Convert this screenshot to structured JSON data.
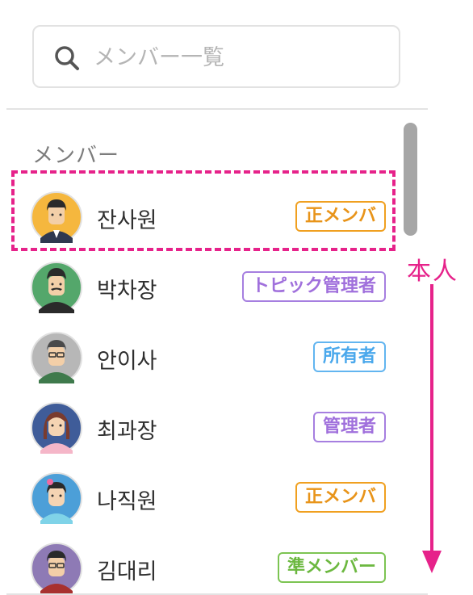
{
  "search": {
    "placeholder": "メンバー一覧",
    "icon": "search-icon"
  },
  "section": {
    "title": "メンバー"
  },
  "members": [
    {
      "name": "잔사원",
      "role": "正メンバ",
      "role_color": "#f0a020",
      "role_text_color": "#e8941a",
      "avatar_bg": "#f5b73e"
    },
    {
      "name": "박차장",
      "role": "トピック管理者",
      "role_color": "#a67fe0",
      "role_text_color": "#a070dc",
      "avatar_bg": "#54a76b"
    },
    {
      "name": "안이사",
      "role": "所有者",
      "role_color": "#62b5f0",
      "role_text_color": "#4aa8ec",
      "avatar_bg": "#b7b7b7"
    },
    {
      "name": "최과장",
      "role": "管理者",
      "role_color": "#a67fe0",
      "role_text_color": "#a070dc",
      "avatar_bg": "#3f5c99"
    },
    {
      "name": "나직원",
      "role": "正メンバ",
      "role_color": "#f0a020",
      "role_text_color": "#e8941a",
      "avatar_bg": "#4c9fd8"
    },
    {
      "name": "김대리",
      "role": "準メンバー",
      "role_color": "#7cc452",
      "role_text_color": "#6cb840",
      "avatar_bg": "#8e7ab5"
    }
  ],
  "annotation": {
    "self_label": "本人",
    "color": "#e6228a"
  },
  "scrollbar": {
    "color": "#a6a6a6"
  }
}
